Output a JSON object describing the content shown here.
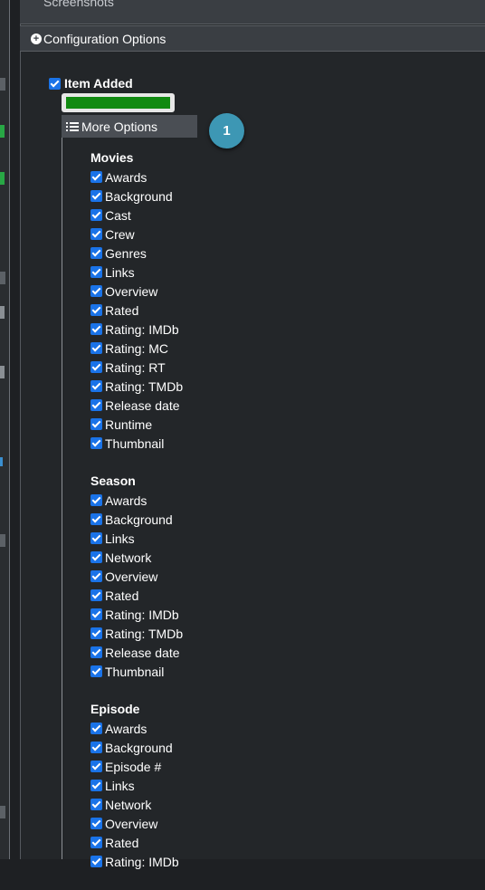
{
  "top_item": {
    "label": "Screenshots"
  },
  "config_header": {
    "title": "Configuration Options"
  },
  "item_added": {
    "label": "Item Added",
    "checked": true,
    "color": "#118a11"
  },
  "more_options": {
    "label": "More Options",
    "badge": "1"
  },
  "groups": [
    {
      "title": "Movies",
      "options": [
        "Awards",
        "Background",
        "Cast",
        "Crew",
        "Genres",
        "Links",
        "Overview",
        "Rated",
        "Rating: IMDb",
        "Rating: MC",
        "Rating: RT",
        "Rating: TMDb",
        "Release date",
        "Runtime",
        "Thumbnail"
      ]
    },
    {
      "title": "Season",
      "options": [
        "Awards",
        "Background",
        "Links",
        "Network",
        "Overview",
        "Rated",
        "Rating: IMDb",
        "Rating: TMDb",
        "Release date",
        "Thumbnail"
      ]
    },
    {
      "title": "Episode",
      "options": [
        "Awards",
        "Background",
        "Episode #",
        "Links",
        "Network",
        "Overview",
        "Rated",
        "Rating: IMDb"
      ]
    }
  ],
  "colors": {
    "accent": "#1a73e8",
    "badge": "#3d97b4",
    "panel": "#232629",
    "header": "#3a3e43"
  }
}
